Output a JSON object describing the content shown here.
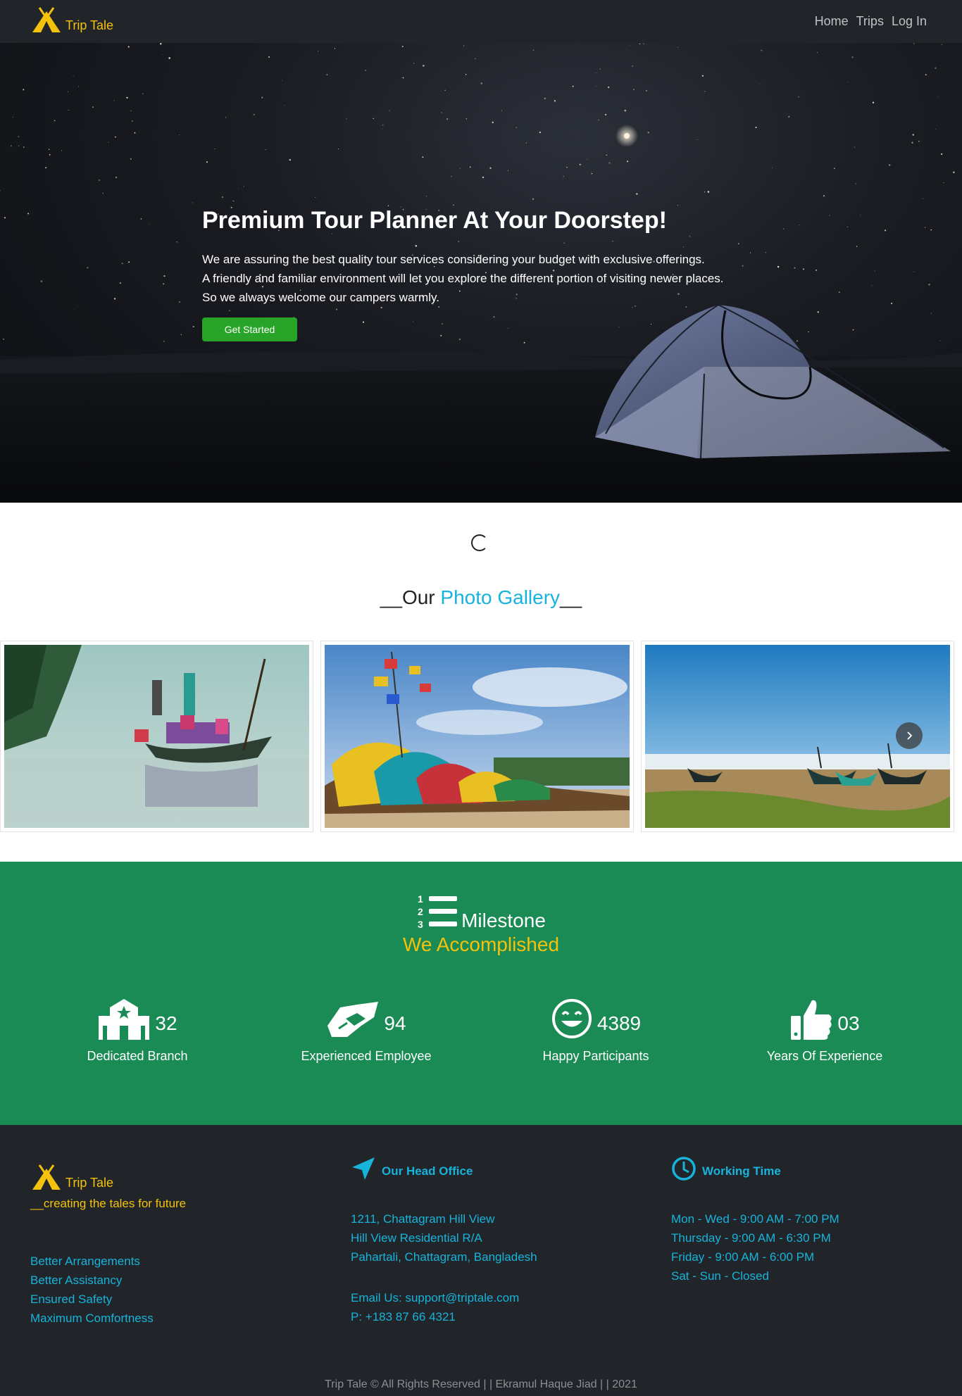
{
  "navbar": {
    "brand": "Trip Tale",
    "links": [
      "Home",
      "Trips",
      "Log In"
    ]
  },
  "hero": {
    "title": "Premium Tour Planner At Your Doorstep!",
    "lines": [
      "We are assuring the best quality tour services considering your budget with exclusive offerings.",
      "A friendly and familiar environment will let you explore the different portion of visiting newer places.",
      "So we always welcome our campers warmly."
    ],
    "cta": "Get Started"
  },
  "gallery": {
    "title_prefix": "__Our ",
    "title_accent": "Photo Gallery",
    "title_suffix": "__"
  },
  "milestone": {
    "title": "Milestone",
    "subtitle": "We Accomplished",
    "stats": [
      {
        "icon": "building-icon",
        "value": "32",
        "label": "Dedicated Branch"
      },
      {
        "icon": "handshake-icon",
        "value": "94",
        "label": "Experienced Employee"
      },
      {
        "icon": "smile-icon",
        "value": "4389",
        "label": "Happy Participants"
      },
      {
        "icon": "thumbs-up-icon",
        "value": "03",
        "label": "Years Of Experience"
      }
    ]
  },
  "footer": {
    "brand": "Trip Tale",
    "tagline": "__creating the tales for future",
    "features": [
      "Better Arrangements",
      "Better Assistancy",
      "Ensured Safety",
      "Maximum Comfortness"
    ],
    "office": {
      "heading": "Our Head Office",
      "address": [
        "1211, Chattagram Hill View",
        "Hill View Residential R/A",
        "Pahartali, Chattagram, Bangladesh"
      ],
      "email": "Email Us: support@triptale.com",
      "phone": "P: +183 87 66 4321"
    },
    "hours": {
      "heading": "Working Time",
      "lines": [
        "Mon - Wed - 9:00 AM - 7:00 PM",
        "Thursday - 9:00 AM - 6:30 PM",
        "Friday - 9:00 AM - 6:00 PM",
        "Sat - Sun - Closed"
      ]
    },
    "copyright": "Trip Tale © All Rights Reserved | | Ekramul Haque Jiad | | 2021"
  },
  "colors": {
    "brand_yellow": "#f4c20d",
    "accent_cyan": "#17b3db",
    "milestone_green": "#1b8b55",
    "dark_bg": "#212529",
    "button_green": "#28a529"
  }
}
